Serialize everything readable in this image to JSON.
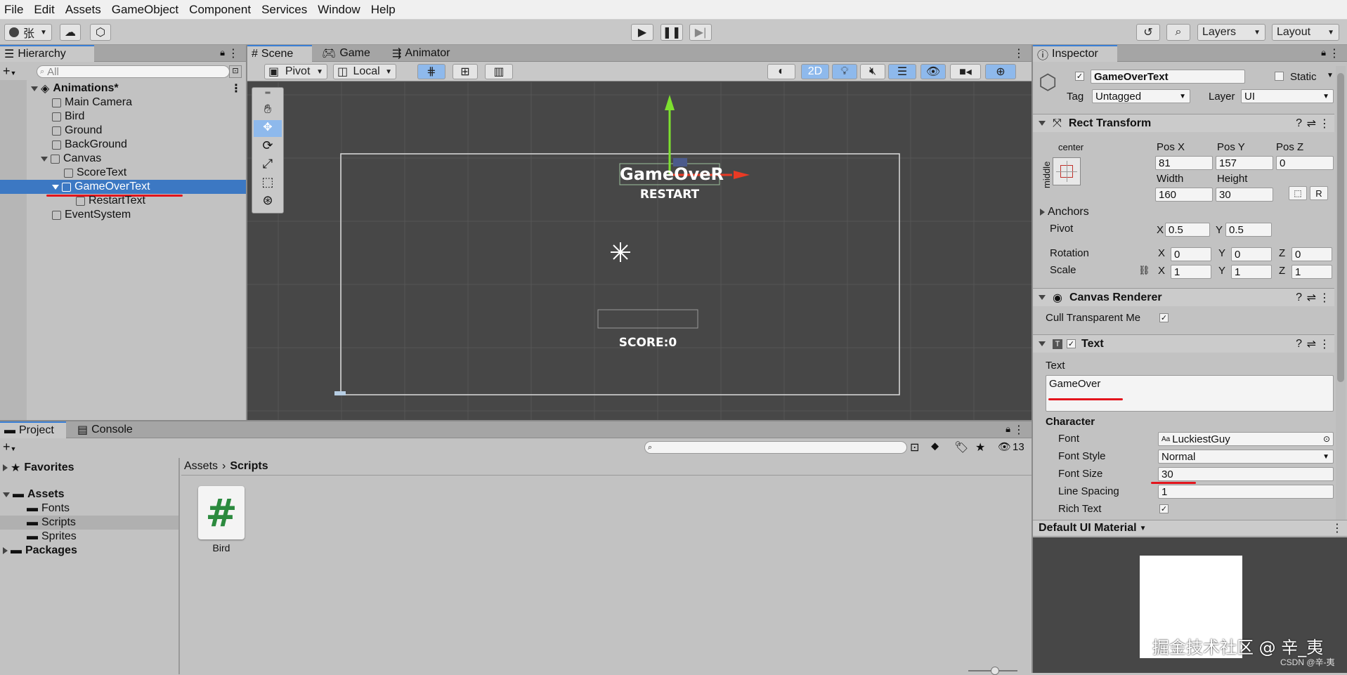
{
  "menu": [
    "File",
    "Edit",
    "Assets",
    "GameObject",
    "Component",
    "Services",
    "Window",
    "Help"
  ],
  "toolbar": {
    "account": "张",
    "layers": "Layers",
    "layout": "Layout"
  },
  "hierarchy": {
    "tab": "Hierarchy",
    "search_placeholder": "All",
    "scene": "Animations*",
    "items": [
      "Main Camera",
      "Bird",
      "Ground",
      "BackGround",
      "Canvas",
      "ScoreText",
      "GameOverText",
      "RestartText",
      "EventSystem"
    ]
  },
  "scene_tabs": [
    "Scene",
    "Game",
    "Animator"
  ],
  "scene_toolbar": {
    "pivot": "Pivot",
    "local": "Local",
    "mode_2d": "2D"
  },
  "scene_view": {
    "gameover": "GameOveR",
    "restart": "RESTART",
    "score": "SCORE:0"
  },
  "inspector": {
    "tab": "Inspector",
    "object_name": "GameOverText",
    "static": "Static",
    "tag_label": "Tag",
    "tag": "Untagged",
    "layer_label": "Layer",
    "layer": "UI",
    "rect": {
      "title": "Rect Transform",
      "anchor_h": "center",
      "anchor_v": "middle",
      "posx_label": "Pos X",
      "posy_label": "Pos Y",
      "posz_label": "Pos Z",
      "posx": "81",
      "posy": "157",
      "posz": "0",
      "width_label": "Width",
      "height_label": "Height",
      "width": "160",
      "height": "30",
      "r_button": "R",
      "anchors": "Anchors",
      "pivot": "Pivot",
      "pivot_x": "0.5",
      "pivot_y": "0.5",
      "rotation": "Rotation",
      "rot_x": "0",
      "rot_y": "0",
      "rot_z": "0",
      "scale": "Scale",
      "scale_x": "1",
      "scale_y": "1",
      "scale_z": "1",
      "x": "X",
      "y": "Y",
      "z": "Z"
    },
    "canvas_renderer": {
      "title": "Canvas Renderer",
      "cull": "Cull Transparent Me"
    },
    "text": {
      "title": "Text",
      "text_label": "Text",
      "text_value": "GameOver",
      "character": "Character",
      "font_label": "Font",
      "font": "LuckiestGuy",
      "font_style_label": "Font Style",
      "font_style": "Normal",
      "font_size_label": "Font Size",
      "font_size": "30",
      "line_spacing_label": "Line Spacing",
      "line_spacing": "1",
      "rich_text_label": "Rich Text"
    },
    "material": "Default UI Material"
  },
  "project": {
    "tabs": [
      "Project",
      "Console"
    ],
    "favorites": "Favorites",
    "assets": "Assets",
    "folders": [
      "Fonts",
      "Scripts",
      "Sprites"
    ],
    "packages": "Packages",
    "breadcrumb_root": "Assets",
    "breadcrumb_current": "Scripts",
    "hidden_count": "13",
    "file_name": "Bird",
    "file_glyph": "#"
  },
  "watermark": {
    "main": "掘金技术社区 @ 辛_夷",
    "sub": "CSDN @辛-夷"
  }
}
